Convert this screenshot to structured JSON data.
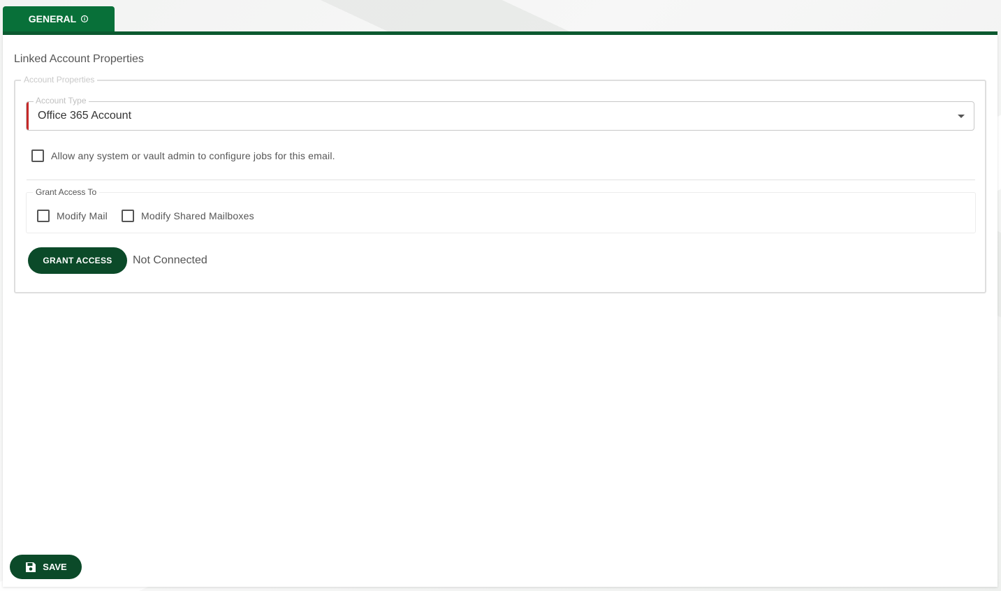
{
  "tabs": [
    {
      "label": "GENERAL",
      "icon": "info-icon",
      "active": true
    }
  ],
  "colors": {
    "accent": "#087039",
    "button": "#0b4a29",
    "error_marker": "#c62828"
  },
  "page": {
    "title": "Linked Account Properties"
  },
  "account_properties": {
    "legend": "Account Properties",
    "account_type": {
      "label": "Account Type",
      "value": "Office 365 Account"
    },
    "allow_admin": {
      "label": "Allow any system or vault admin to configure jobs for this email.",
      "checked": false
    }
  },
  "grant_access": {
    "legend": "Grant Access To",
    "options": [
      {
        "label": "Modify Mail",
        "checked": false
      },
      {
        "label": "Modify Shared Mailboxes",
        "checked": false
      }
    ],
    "button_label": "GRANT ACCESS",
    "status": "Not Connected"
  },
  "footer": {
    "save_label": "SAVE",
    "save_icon": "floppy-disk-icon"
  }
}
